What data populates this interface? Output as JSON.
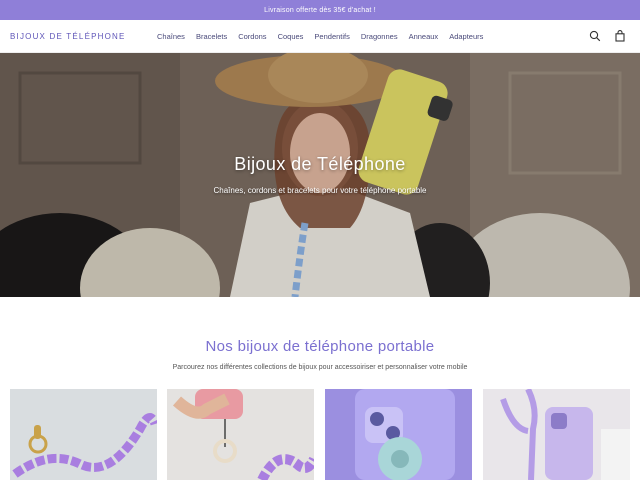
{
  "announcement": {
    "text": "Livraison offerte dès 35€ d'achat !"
  },
  "header": {
    "logo": "BIJOUX DE TÉLÉPHONE",
    "nav": [
      "Chaînes",
      "Bracelets",
      "Cordons",
      "Coques",
      "Pendentifs",
      "Dragonnes",
      "Anneaux",
      "Adapteurs"
    ],
    "icons": [
      "search-icon",
      "bag-icon"
    ]
  },
  "hero": {
    "title": "Bijoux de Téléphone",
    "subtitle": "Chaînes, cordons et bracelets pour votre téléphone portable"
  },
  "collections": {
    "title": "Nos bijoux de téléphone portable",
    "subtitle": "Parcourez nos différentes collections de bijoux pour accessoiriser et personnaliser votre mobile"
  },
  "colors": {
    "accent": "#8f7fd8",
    "title": "#7b70d0",
    "logo": "#5f55b8"
  }
}
